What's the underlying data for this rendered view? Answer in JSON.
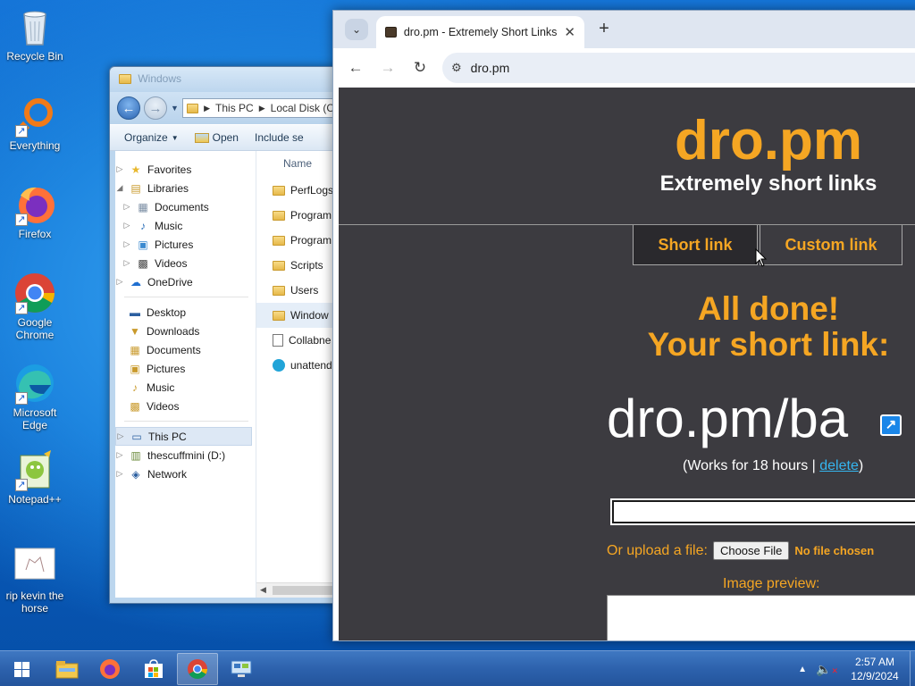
{
  "desktop": {
    "icons": [
      {
        "label": "Recycle Bin",
        "icon": "recycle-bin-icon"
      },
      {
        "label": "Everything",
        "icon": "everything-search-icon"
      },
      {
        "label": "Firefox",
        "icon": "firefox-icon"
      },
      {
        "label": "Google Chrome",
        "icon": "chrome-icon"
      },
      {
        "label": "Microsoft Edge",
        "icon": "edge-icon"
      },
      {
        "label": "Notepad++",
        "icon": "notepad-plus-plus-icon"
      },
      {
        "label": "rip kevin the horse",
        "icon": "image-file-icon"
      }
    ]
  },
  "explorer": {
    "title": "Windows",
    "address": [
      "This PC",
      "Local Disk (C"
    ],
    "commands": {
      "organize": "Organize",
      "open": "Open",
      "include": "Include se"
    },
    "nav": {
      "favorites": "Favorites",
      "libraries": "Libraries",
      "lib_documents": "Documents",
      "lib_music": "Music",
      "lib_pictures": "Pictures",
      "lib_videos": "Videos",
      "onedrive": "OneDrive",
      "desktop": "Desktop",
      "downloads": "Downloads",
      "documents": "Documents",
      "pictures": "Pictures",
      "music": "Music",
      "videos": "Videos",
      "thispc": "This PC",
      "drive_d": "thescuffmini (D:)",
      "network": "Network"
    },
    "column_name": "Name",
    "files": [
      "PerfLogs",
      "Program",
      "Program",
      "Scripts",
      "Users",
      "Window",
      "Collabne",
      "unattend"
    ]
  },
  "browser": {
    "tab_title": "dro.pm - Extremely Short Links",
    "url": "dro.pm",
    "page": {
      "logo": "dro.pm",
      "tagline": "Extremely short links",
      "tab_short": "Short link",
      "tab_custom": "Custom link",
      "done_line1": "All done!",
      "done_line2": "Your short link:",
      "short_link": "dro.pm/ba",
      "works_prefix": "(Works for 18 hours | ",
      "delete_link": "delete",
      "works_suffix": ")",
      "upload_label": "Or upload a file:",
      "choose_file": "Choose File",
      "no_file": "No file chosen",
      "preview_label": "Image preview:"
    },
    "colors": {
      "accent": "#f5a623",
      "page_bg": "#3c3b40",
      "link": "#35b6f0"
    }
  },
  "taskbar": {
    "apps": [
      "file-explorer-icon",
      "firefox-icon",
      "store-icon",
      "chrome-icon",
      "remote-desktop-icon"
    ],
    "time": "2:57 AM",
    "date": "12/9/2024"
  }
}
